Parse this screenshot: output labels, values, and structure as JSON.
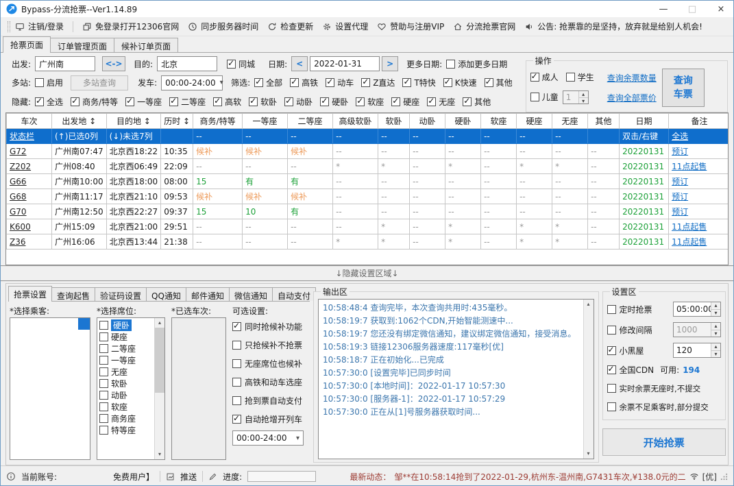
{
  "window": {
    "title": "Bypass-分流抢票--Ver1.14.89",
    "controls": {
      "minimize": "—",
      "maximize": "□",
      "close": "×"
    }
  },
  "toolbar": {
    "items": [
      {
        "icon": "monitor-icon",
        "label": "注销/登录"
      },
      {
        "icon": "window-icon",
        "label": "免登录打开12306官网"
      },
      {
        "icon": "clock-icon",
        "label": "同步服务器时间"
      },
      {
        "icon": "refresh-icon",
        "label": "检查更新"
      },
      {
        "icon": "gear-icon",
        "label": "设置代理"
      },
      {
        "icon": "heart-icon",
        "label": "赞助与注册VIP"
      },
      {
        "icon": "home-icon",
        "label": "分流抢票官网"
      }
    ],
    "announcement": "公告: 抢票靠的是坚持，放弃就是给别人机会!"
  },
  "page_tabs": [
    {
      "label": "抢票页面",
      "active": true
    },
    {
      "label": "订单管理页面",
      "active": false
    },
    {
      "label": "候补订单页面",
      "active": false
    }
  ],
  "search": {
    "depart_label": "出发:",
    "depart_value": "广州南",
    "swap_label": "<->",
    "dest_label": "目的:",
    "dest_value": "北京",
    "same_city_label": "同城",
    "date_label": "日期:",
    "prev_label": "<",
    "date_value": "2022-01-31",
    "next_label": ">",
    "more_dates_label": "更多日期:",
    "add_more_dates_label": "添加更多日期",
    "multi_label": "多站:",
    "enable_label": "启用",
    "multi_query_button": "多站查询",
    "depart_time_label": "发车:",
    "depart_time_value": "00:00-24:00",
    "filter_label": "筛选:",
    "filter_options": [
      {
        "label": "全部",
        "checked": true
      },
      {
        "label": "高铁",
        "checked": true
      },
      {
        "label": "动车",
        "checked": true
      },
      {
        "label": "Z直达",
        "checked": true
      },
      {
        "label": "T特快",
        "checked": true
      },
      {
        "label": "K快速",
        "checked": true
      },
      {
        "label": "其他",
        "checked": true
      }
    ],
    "hide_label": "隐藏:",
    "hide_options": [
      {
        "label": "全选",
        "checked": true
      },
      {
        "label": "商务/特等",
        "checked": true
      },
      {
        "label": "一等座",
        "checked": true
      },
      {
        "label": "二等座",
        "checked": true
      },
      {
        "label": "高软",
        "checked": true
      },
      {
        "label": "软卧",
        "checked": true
      },
      {
        "label": "动卧",
        "checked": true
      },
      {
        "label": "硬卧",
        "checked": true
      },
      {
        "label": "软座",
        "checked": true
      },
      {
        "label": "硬座",
        "checked": true
      },
      {
        "label": "无座",
        "checked": true
      },
      {
        "label": "其他",
        "checked": true
      }
    ]
  },
  "operation": {
    "title": "操作",
    "adult_label": "成人",
    "student_label": "学生",
    "child_label": "儿童",
    "child_count": "1",
    "query_remaining_link": "查询余票数量",
    "query_price_link": "查询全部票价",
    "query_button": "查询车票"
  },
  "table": {
    "columns": [
      "车次",
      "出发地 ↕",
      "目的地 ↕",
      "历时 ↕",
      "商务/特等",
      "一等座",
      "二等座",
      "高级软卧",
      "软卧",
      "动卧",
      "硬卧",
      "软座",
      "硬座",
      "无座",
      "其他",
      "日期",
      "备注"
    ],
    "status_row": {
      "cells": [
        "状态栏",
        "(↑)已选0列",
        "(↓)未选7列",
        "",
        "--",
        "--",
        "--",
        "--",
        "--",
        "--",
        "--",
        "--",
        "--",
        "--",
        "",
        "双击/右键",
        "全选"
      ]
    },
    "rows": [
      {
        "cells": [
          "G72",
          "广州南07:47",
          "北京西18:22",
          "10:35",
          "候补",
          "候补",
          "候补",
          "--",
          "--",
          "--",
          "--",
          "--",
          "--",
          "--",
          "--",
          "20220131",
          "预订"
        ]
      },
      {
        "cells": [
          "Z202",
          "广州08:40",
          "北京西06:49",
          "22:09",
          "--",
          "--",
          "--",
          "*",
          "*",
          "--",
          "*",
          "--",
          "*",
          "*",
          "--",
          "20220131",
          "11点起售"
        ]
      },
      {
        "cells": [
          "G66",
          "广州南10:00",
          "北京西18:00",
          "08:00",
          "15",
          "有",
          "有",
          "--",
          "--",
          "--",
          "--",
          "--",
          "--",
          "--",
          "--",
          "20220131",
          "预订"
        ]
      },
      {
        "cells": [
          "G68",
          "广州南11:17",
          "北京西21:10",
          "09:53",
          "候补",
          "候补",
          "候补",
          "--",
          "--",
          "--",
          "--",
          "--",
          "--",
          "--",
          "--",
          "20220131",
          "预订"
        ]
      },
      {
        "cells": [
          "G70",
          "广州南12:50",
          "北京西22:27",
          "09:37",
          "15",
          "10",
          "有",
          "--",
          "--",
          "--",
          "--",
          "--",
          "--",
          "--",
          "--",
          "20220131",
          "预订"
        ]
      },
      {
        "cells": [
          "K600",
          "广州15:09",
          "北京西21:00",
          "29:51",
          "--",
          "--",
          "--",
          "--",
          "*",
          "--",
          "*",
          "--",
          "*",
          "*",
          "--",
          "20220131",
          "11点起售"
        ]
      },
      {
        "cells": [
          "Z36",
          "广州16:06",
          "北京西13:44",
          "21:38",
          "--",
          "--",
          "--",
          "*",
          "*",
          "--",
          "*",
          "--",
          "*",
          "*",
          "--",
          "20220131",
          "11点起售"
        ]
      }
    ]
  },
  "divider_label": "↓隐藏设置区域↓",
  "grab_settings": {
    "tabs": [
      {
        "label": "抢票设置",
        "active": true
      },
      {
        "label": "查询起售",
        "active": false
      },
      {
        "label": "验证码设置",
        "active": false
      },
      {
        "label": "QQ通知",
        "active": false
      },
      {
        "label": "邮件通知",
        "active": false
      },
      {
        "label": "微信通知",
        "active": false
      },
      {
        "label": "自动支付",
        "active": false
      }
    ],
    "passengers_label": "*选择乘客:",
    "seats_label": "*选择席位:",
    "trains_label": "*已选车次:",
    "options_label": "可选设置:",
    "seat_options": [
      "硬卧",
      "硬座",
      "二等座",
      "一等座",
      "无座",
      "软卧",
      "动卧",
      "软座",
      "商务座",
      "特等座"
    ],
    "options": [
      {
        "label": "同时抢候补功能",
        "checked": true
      },
      {
        "label": "只抢候补不抢票",
        "checked": false
      },
      {
        "label": "无座席位也候补",
        "checked": false
      },
      {
        "label": "高铁和动车选座",
        "checked": false
      },
      {
        "label": "抢到票自动支付",
        "checked": false
      },
      {
        "label": "自动抢增开列车",
        "checked": true
      }
    ],
    "time_range_value": "00:00-24:00"
  },
  "output": {
    "title": "输出区",
    "lines": [
      "10:58:48:4  查询完毕，本次查询共用时:435毫秒。",
      "10:58:19:7  获取到:1062个CDN,开始智能测速中...",
      "10:58:19:7  您还没有绑定微信通知，建议绑定微信通知，接受消息。",
      "10:58:19:3  链接12306服务器速度:117毫秒[优]",
      "10:58:18:7  正在初始化...已完成",
      "10:57:30:0  [设置完毕]已同步时间",
      "10:57:30:0  [本地时间]：2022-01-17 10:57:30",
      "10:57:30:0  [服务器-1]：2022-01-17 10:57:29",
      "10:57:30:0  正在从[1]号服务器获取时间..."
    ]
  },
  "settings": {
    "title": "设置区",
    "rows": [
      {
        "label": "定时抢票",
        "checked": false,
        "value": "05:00:00",
        "disabled": false
      },
      {
        "label": "修改间隔",
        "checked": false,
        "value": "1000",
        "disabled": true
      },
      {
        "label": "小黑屋",
        "checked": true,
        "value": "120",
        "disabled": false
      }
    ],
    "cdn": {
      "label": "全国CDN",
      "checked": true,
      "avail_label": "可用:",
      "avail_value": "194"
    },
    "extra": [
      {
        "label": "实时余票无座时,不提交",
        "checked": false
      },
      {
        "label": "余票不足乘客时,部分提交",
        "checked": false
      }
    ],
    "start_button": "开始抢票"
  },
  "statusbar": {
    "account_label": "当前账号:",
    "account_value": "免费用户】",
    "push_label": "推送",
    "progress_label": "进度:",
    "latest_label": "最新动态：",
    "latest_text": "邹**在10:58:14抢到了2022-01-29,杭州东-温州南,G7431车次,¥138.0元的二",
    "signal_label": "[优]"
  }
}
